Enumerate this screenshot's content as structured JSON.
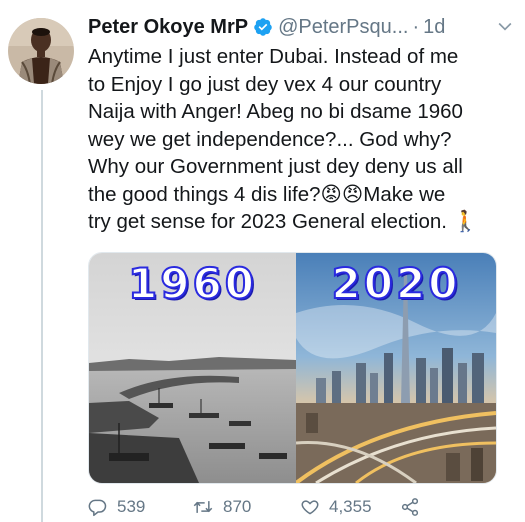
{
  "tweet": {
    "author_name": "Peter Okoye MrP",
    "handle": "@PeterPsqu...",
    "separator": "·",
    "time": "1d",
    "text": "Anytime I just enter Dubai. Instead of me\nto Enjoy I go just dey vex 4 our country\nNaija with Anger! Abeg no bi dsame 1960\nwey we get independence?... God why?\nWhy our Government just dey deny us all\nthe good things 4 dis life?😡😠Make we\ntry get sense for 2023 General election. 🚶"
  },
  "media": {
    "left_year": "1960",
    "right_year": "2020"
  },
  "actions": {
    "reply_count": "539",
    "retweet_count": "870",
    "like_count": "4,355"
  },
  "colors": {
    "verified_badge": "#1da1f2",
    "icon_gray": "#657786",
    "year_outline": "#2a2adf"
  },
  "icons": {
    "verified": "verified-badge-icon",
    "more": "chevron-down-icon",
    "reply": "reply-icon",
    "retweet": "retweet-icon",
    "like": "heart-icon",
    "share": "share-icon"
  }
}
